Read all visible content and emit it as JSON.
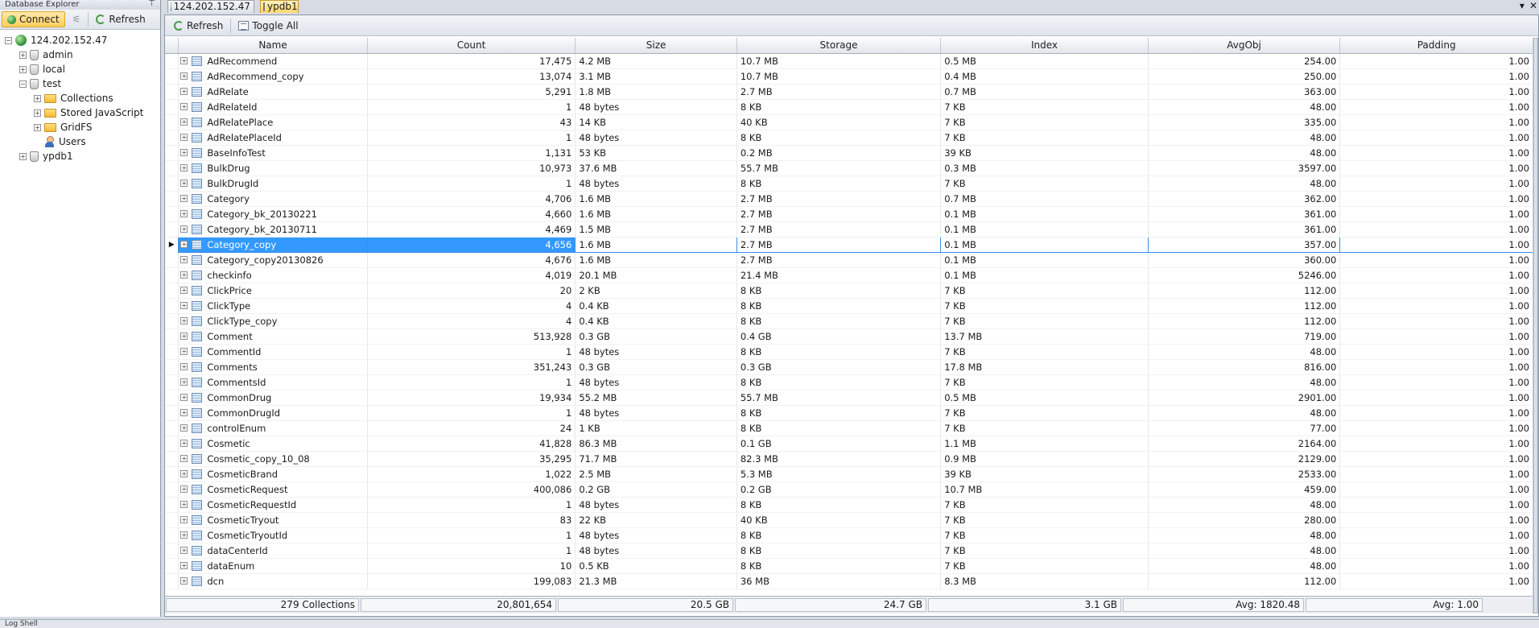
{
  "left_panel": {
    "title": "Database Explorer",
    "pin": "⊤",
    "toolbar": {
      "connect": "Connect",
      "refresh": "Refresh"
    },
    "tree": [
      {
        "level": 0,
        "exp": "−",
        "icon": "server",
        "label": "124.202.152.47"
      },
      {
        "level": 1,
        "exp": "+",
        "icon": "db",
        "label": "admin"
      },
      {
        "level": 1,
        "exp": "+",
        "icon": "db",
        "label": "local"
      },
      {
        "level": 1,
        "exp": "−",
        "icon": "db",
        "label": "test"
      },
      {
        "level": 2,
        "exp": "+",
        "icon": "folder",
        "label": "Collections"
      },
      {
        "level": 2,
        "exp": "+",
        "icon": "folder",
        "label": "Stored JavaScript"
      },
      {
        "level": 2,
        "exp": "+",
        "icon": "folder",
        "label": "GridFS"
      },
      {
        "level": 2,
        "exp": "",
        "icon": "user",
        "label": "Users"
      },
      {
        "level": 1,
        "exp": "+",
        "icon": "db",
        "label": "ypdb1"
      }
    ]
  },
  "tabs": [
    {
      "label": "124.202.152.47",
      "icon": "server"
    },
    {
      "label": "ypdb1",
      "icon": "db",
      "active": true
    }
  ],
  "window_controls": {
    "menu": "▾",
    "close": "✕"
  },
  "main_toolbar": {
    "refresh": "Refresh",
    "toggle_all": "Toggle All"
  },
  "grid": {
    "columns": [
      "Name",
      "Count",
      "Size",
      "Storage",
      "Index",
      "AvgObj",
      "Padding"
    ],
    "selected_row": 12,
    "rows": [
      [
        "AdRecommend",
        "17,475",
        "4.2 MB",
        "10.7 MB",
        "0.5 MB",
        "254.00",
        "1.00"
      ],
      [
        "AdRecommend_copy",
        "13,074",
        "3.1 MB",
        "10.7 MB",
        "0.4 MB",
        "250.00",
        "1.00"
      ],
      [
        "AdRelate",
        "5,291",
        "1.8 MB",
        "2.7 MB",
        "0.7 MB",
        "363.00",
        "1.00"
      ],
      [
        "AdRelateId",
        "1",
        "48 bytes",
        "8 KB",
        "7 KB",
        "48.00",
        "1.00"
      ],
      [
        "AdRelatePlace",
        "43",
        "14 KB",
        "40 KB",
        "7 KB",
        "335.00",
        "1.00"
      ],
      [
        "AdRelatePlaceId",
        "1",
        "48 bytes",
        "8 KB",
        "7 KB",
        "48.00",
        "1.00"
      ],
      [
        "BaseInfoTest",
        "1,131",
        "53 KB",
        "0.2 MB",
        "39 KB",
        "48.00",
        "1.00"
      ],
      [
        "BulkDrug",
        "10,973",
        "37.6 MB",
        "55.7 MB",
        "0.3 MB",
        "3597.00",
        "1.00"
      ],
      [
        "BulkDrugId",
        "1",
        "48 bytes",
        "8 KB",
        "7 KB",
        "48.00",
        "1.00"
      ],
      [
        "Category",
        "4,706",
        "1.6 MB",
        "2.7 MB",
        "0.7 MB",
        "362.00",
        "1.00"
      ],
      [
        "Category_bk_20130221",
        "4,660",
        "1.6 MB",
        "2.7 MB",
        "0.1 MB",
        "361.00",
        "1.00"
      ],
      [
        "Category_bk_20130711",
        "4,469",
        "1.5 MB",
        "2.7 MB",
        "0.1 MB",
        "361.00",
        "1.00"
      ],
      [
        "Category_copy",
        "4,656",
        "1.6 MB",
        "2.7 MB",
        "0.1 MB",
        "357.00",
        "1.00"
      ],
      [
        "Category_copy20130826",
        "4,676",
        "1.6 MB",
        "2.7 MB",
        "0.1 MB",
        "360.00",
        "1.00"
      ],
      [
        "checkinfo",
        "4,019",
        "20.1 MB",
        "21.4 MB",
        "0.1 MB",
        "5246.00",
        "1.00"
      ],
      [
        "ClickPrice",
        "20",
        "2 KB",
        "8 KB",
        "7 KB",
        "112.00",
        "1.00"
      ],
      [
        "ClickType",
        "4",
        "0.4 KB",
        "8 KB",
        "7 KB",
        "112.00",
        "1.00"
      ],
      [
        "ClickType_copy",
        "4",
        "0.4 KB",
        "8 KB",
        "7 KB",
        "112.00",
        "1.00"
      ],
      [
        "Comment",
        "513,928",
        "0.3 GB",
        "0.4 GB",
        "13.7 MB",
        "719.00",
        "1.00"
      ],
      [
        "CommentId",
        "1",
        "48 bytes",
        "8 KB",
        "7 KB",
        "48.00",
        "1.00"
      ],
      [
        "Comments",
        "351,243",
        "0.3 GB",
        "0.3 GB",
        "17.8 MB",
        "816.00",
        "1.00"
      ],
      [
        "CommentsId",
        "1",
        "48 bytes",
        "8 KB",
        "7 KB",
        "48.00",
        "1.00"
      ],
      [
        "CommonDrug",
        "19,934",
        "55.2 MB",
        "55.7 MB",
        "0.5 MB",
        "2901.00",
        "1.00"
      ],
      [
        "CommonDrugId",
        "1",
        "48 bytes",
        "8 KB",
        "7 KB",
        "48.00",
        "1.00"
      ],
      [
        "controlEnum",
        "24",
        "1 KB",
        "8 KB",
        "7 KB",
        "77.00",
        "1.00"
      ],
      [
        "Cosmetic",
        "41,828",
        "86.3 MB",
        "0.1 GB",
        "1.1 MB",
        "2164.00",
        "1.00"
      ],
      [
        "Cosmetic_copy_10_08",
        "35,295",
        "71.7 MB",
        "82.3 MB",
        "0.9 MB",
        "2129.00",
        "1.00"
      ],
      [
        "CosmeticBrand",
        "1,022",
        "2.5 MB",
        "5.3 MB",
        "39 KB",
        "2533.00",
        "1.00"
      ],
      [
        "CosmeticRequest",
        "400,086",
        "0.2 GB",
        "0.2 GB",
        "10.7 MB",
        "459.00",
        "1.00"
      ],
      [
        "CosmeticRequestId",
        "1",
        "48 bytes",
        "8 KB",
        "7 KB",
        "48.00",
        "1.00"
      ],
      [
        "CosmeticTryout",
        "83",
        "22 KB",
        "40 KB",
        "7 KB",
        "280.00",
        "1.00"
      ],
      [
        "CosmeticTryoutId",
        "1",
        "48 bytes",
        "8 KB",
        "7 KB",
        "48.00",
        "1.00"
      ],
      [
        "dataCenterId",
        "1",
        "48 bytes",
        "8 KB",
        "7 KB",
        "48.00",
        "1.00"
      ],
      [
        "dataEnum",
        "10",
        "0.5 KB",
        "8 KB",
        "7 KB",
        "48.00",
        "1.00"
      ],
      [
        "dcn",
        "199,083",
        "21.3 MB",
        "36 MB",
        "8.3 MB",
        "112.00",
        "1.00"
      ]
    ],
    "footer": [
      "279 Collections",
      "20,801,654",
      "20.5 GB",
      "24.7 GB",
      "3.1 GB",
      "Avg: 1820.48",
      "Avg: 1.00"
    ]
  },
  "statusbar": {
    "text": "Log Shell"
  }
}
